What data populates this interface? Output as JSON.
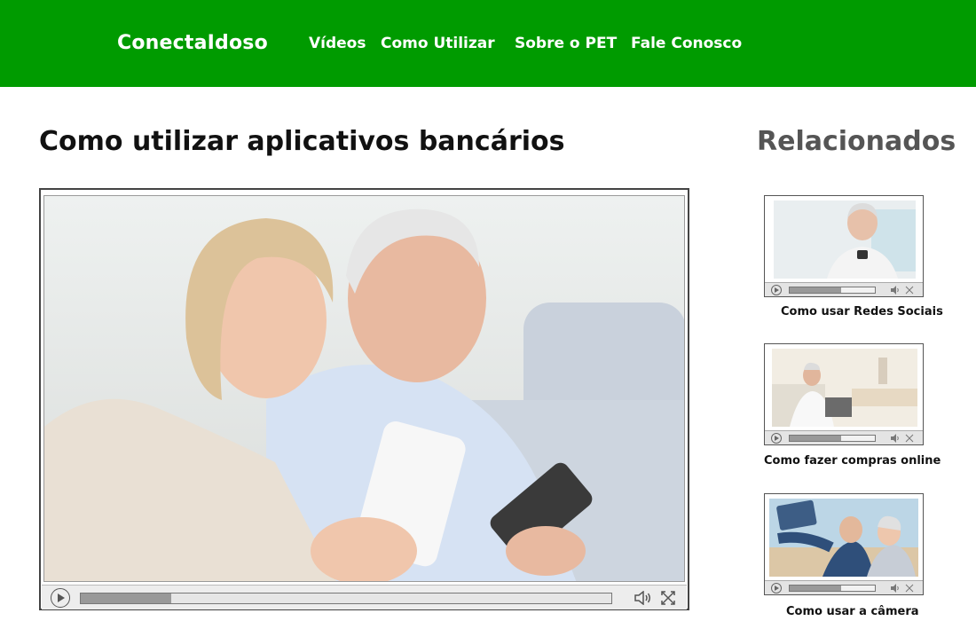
{
  "header": {
    "brand": "ConectaIdoso",
    "nav": [
      "Vídeos",
      "Como Utilizar",
      "Sobre o PET",
      "Fale Conosco"
    ],
    "bg_color": "#009b00"
  },
  "main": {
    "title": "Como utilizar aplicativos bancários",
    "player": {
      "progress": 0.17
    }
  },
  "sidebar": {
    "title": "Relacionados",
    "items": [
      {
        "caption": "Como usar Redes Sociais",
        "progress": 0.6
      },
      {
        "caption": "Como fazer compras online",
        "progress": 0.6
      },
      {
        "caption": "Como usar a câmera",
        "progress": 0.6
      }
    ]
  }
}
